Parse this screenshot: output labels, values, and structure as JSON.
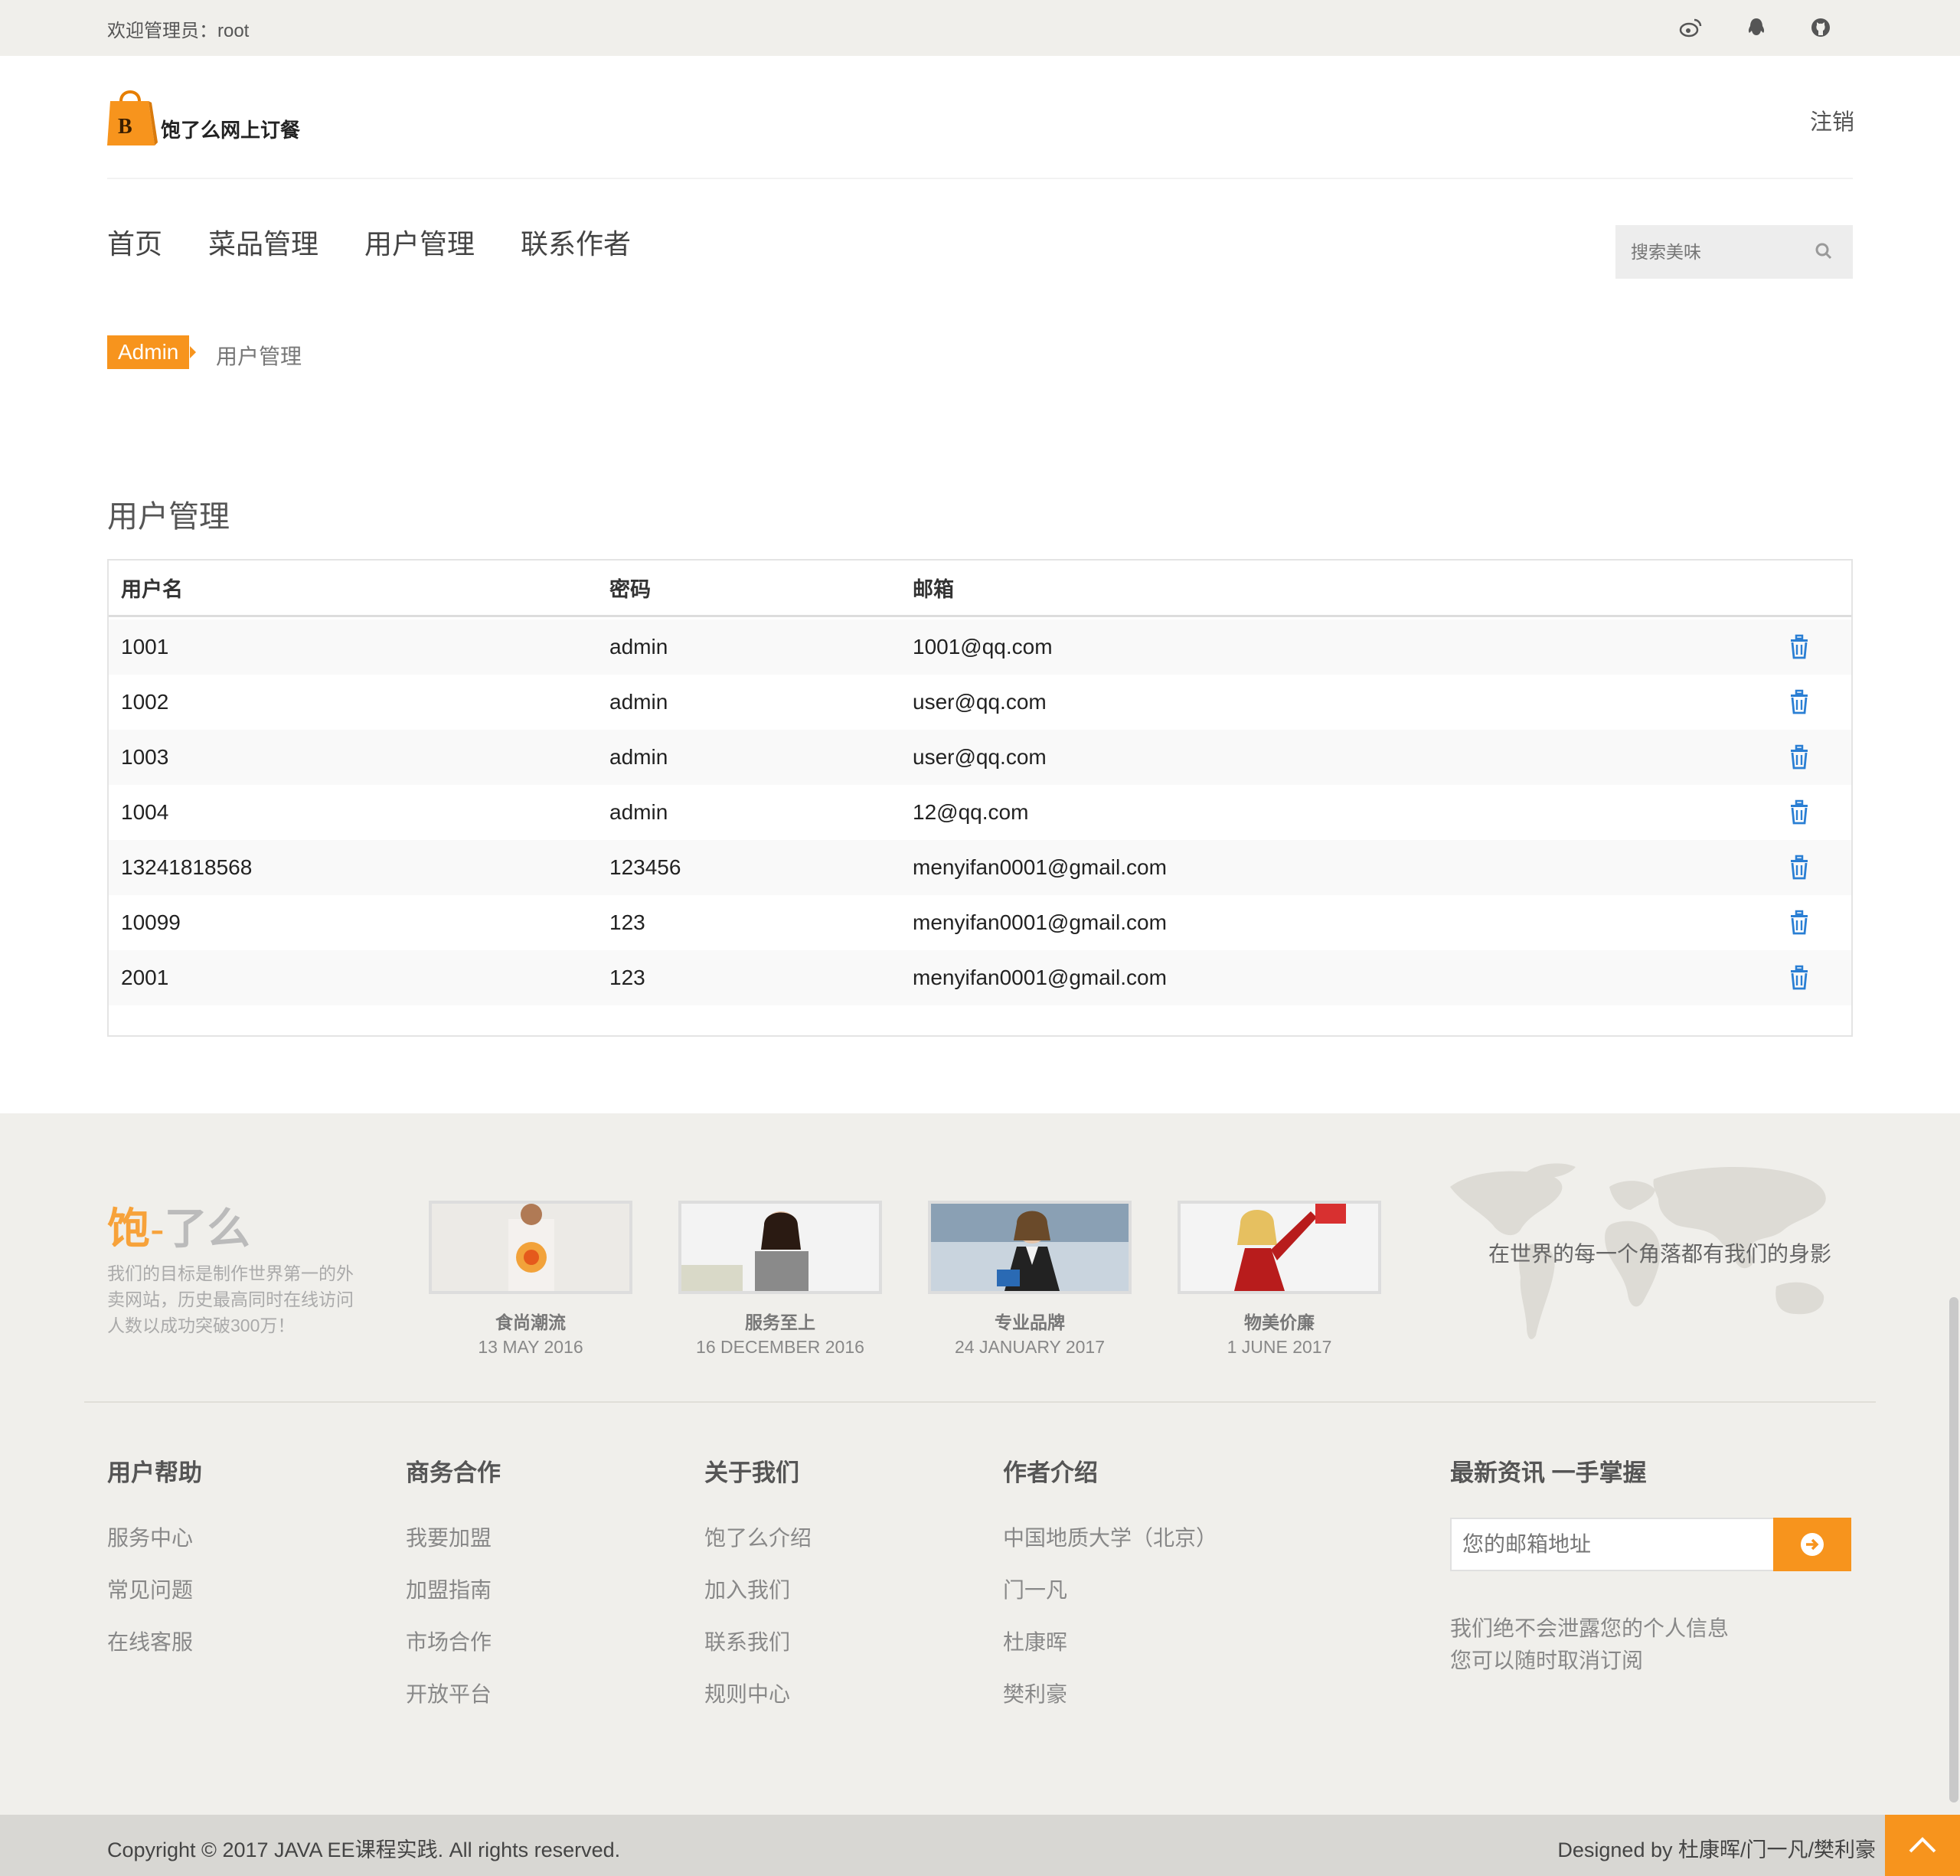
{
  "topbar": {
    "welcome": "欢迎管理员：root",
    "social": [
      "weibo-icon",
      "qq-icon",
      "github-icon"
    ]
  },
  "header": {
    "logo_letter": "B",
    "logo_text": "饱了么网上订餐",
    "logout": "注销"
  },
  "nav": {
    "items": [
      "首页",
      "菜品管理",
      "用户管理",
      "联系作者"
    ],
    "search_placeholder": "搜索美味"
  },
  "breadcrumb": {
    "root": "Admin",
    "current": "用户管理"
  },
  "main": {
    "title": "用户管理",
    "columns": [
      "用户名",
      "密码",
      "邮箱"
    ],
    "rows": [
      {
        "username": "1001",
        "password": "admin",
        "email": "1001@qq.com"
      },
      {
        "username": "1002",
        "password": "admin",
        "email": "user@qq.com"
      },
      {
        "username": "1003",
        "password": "admin",
        "email": "user@qq.com"
      },
      {
        "username": "1004",
        "password": "admin",
        "email": "12@qq.com"
      },
      {
        "username": "13241818568",
        "password": "123456",
        "email": "menyifan0001@gmail.com"
      },
      {
        "username": "10099",
        "password": "123",
        "email": "menyifan0001@gmail.com"
      },
      {
        "username": "2001",
        "password": "123",
        "email": "menyifan0001@gmail.com"
      }
    ]
  },
  "footer": {
    "brand_main": "饱",
    "brand_dash": "-",
    "brand_rest": "了么",
    "brand_desc": "我们的目标是制作世界第一的外卖网站，历史最高同时在线访问人数以成功突破300万！",
    "news": [
      {
        "title": "食尚潮流",
        "date": "13 MAY 2016"
      },
      {
        "title": "服务至上",
        "date": "16 DECEMBER 2016"
      },
      {
        "title": "专业品牌",
        "date": "24 JANUARY 2017"
      },
      {
        "title": "物美价廉",
        "date": "1 JUNE 2017"
      }
    ],
    "world_text": "在世界的每一个角落都有我们的身影",
    "columns": [
      {
        "title": "用户帮助",
        "links": [
          "服务中心",
          "常见问题",
          "在线客服"
        ]
      },
      {
        "title": "商务合作",
        "links": [
          "我要加盟",
          "加盟指南",
          "市场合作",
          "开放平台"
        ]
      },
      {
        "title": "关于我们",
        "links": [
          "饱了么介绍",
          "加入我们",
          "联系我们",
          "规则中心"
        ]
      },
      {
        "title": "作者介绍",
        "links": [
          "中国地质大学（北京）",
          "门一凡",
          "杜康晖",
          "樊利豪"
        ]
      }
    ],
    "subscribe": {
      "title": "最新资讯 一手掌握",
      "placeholder": "您的邮箱地址",
      "note1": "我们绝不会泄露您的个人信息",
      "note2": "您可以随时取消订阅"
    }
  },
  "bottombar": {
    "copyright": "Copyright © 2017 JAVA EE课程实践. All rights reserved.",
    "designed": "Designed by 杜康晖/门一凡/樊利豪"
  },
  "colors": {
    "accent": "#f7941d",
    "delete_icon": "#2a7fd4",
    "topbar_bg": "#f0efeb",
    "footer_bg": "#f0efeb"
  }
}
